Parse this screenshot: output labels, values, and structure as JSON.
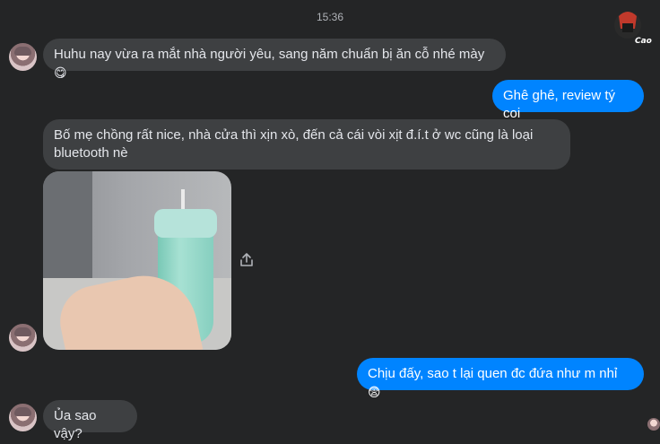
{
  "header": {
    "timestamp": "15:36"
  },
  "watermark": {
    "text": "Cao Thủ"
  },
  "messages": [
    {
      "text": "Huhu nay vừa ra mắt nhà người yêu, sang năm chuẩn bị ăn cỗ nhé mày",
      "emoji": "😋"
    },
    {
      "text": "Ghê ghê, review tý coi"
    },
    {
      "text": "Bố mẹ chồng rất nice, nhà cửa thì xịn xò, đến cả cái vòi xịt đ.í.t ở wc cũng là loại bluetooth nè"
    },
    {
      "text": "Chịu đấy, sao t lại quen đc đứa như m nhỉ",
      "emoji": "😨"
    },
    {
      "text": "Ủa sao vậy?"
    }
  ],
  "icons": {
    "share": "share-icon",
    "avatar": "avatar",
    "seen": "seen-avatar"
  }
}
